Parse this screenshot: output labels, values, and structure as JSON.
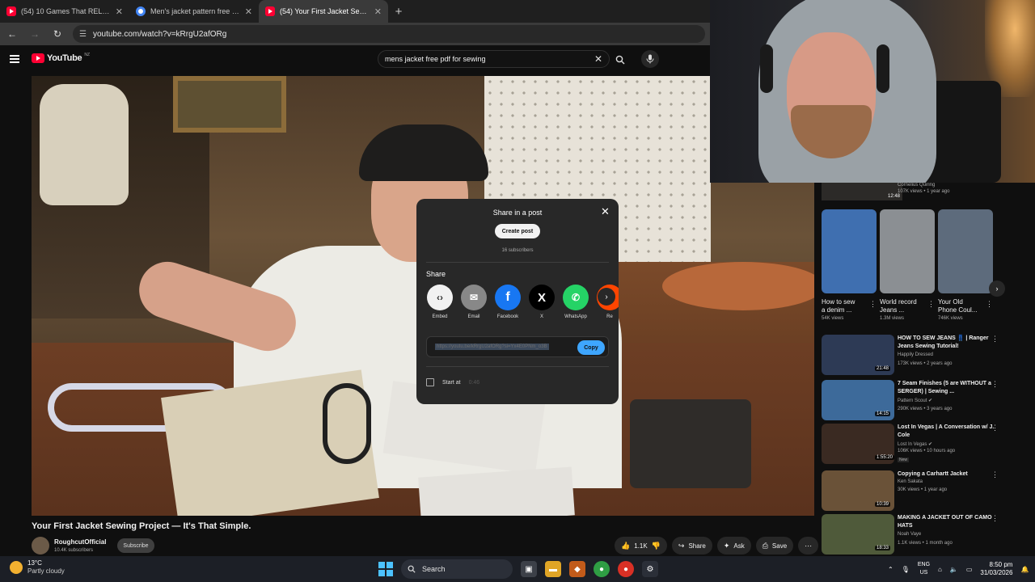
{
  "browser": {
    "tabs": [
      {
        "title": "(54) 10 Games That RELEASED",
        "icon": "youtube-icon",
        "active": false
      },
      {
        "title": "Men's jacket pattern free pdf fo",
        "icon": "google-icon",
        "active": false
      },
      {
        "title": "(54) Your First Jacket Sewing Pr",
        "icon": "youtube-icon",
        "active": true
      }
    ],
    "close_glyph": "✕",
    "new_tab_glyph": "+",
    "url": "youtube.com/watch?v=kRrgU2afORg"
  },
  "youtube": {
    "logo_text": "YouTube",
    "logo_country": "NZ",
    "search_query": "mens jacket free pdf for sewing",
    "clear_glyph": "✕"
  },
  "share_dialog": {
    "title": "Share in a post",
    "create_post": "Create post",
    "subscribers": "16 subscribers",
    "share_label": "Share",
    "targets": [
      {
        "label": "Embed",
        "glyph": "‹›",
        "color": "#f1f1f1",
        "icon": "embed-icon"
      },
      {
        "label": "Email",
        "glyph": "✉",
        "color": "#888888",
        "icon": "email-icon"
      },
      {
        "label": "Facebook",
        "glyph": "f",
        "color": "#1877f2",
        "icon": "facebook-icon"
      },
      {
        "label": "X",
        "glyph": "X",
        "color": "#000000",
        "icon": "x-icon"
      },
      {
        "label": "WhatsApp",
        "glyph": "✆",
        "color": "#25d366",
        "icon": "whatsapp-icon"
      },
      {
        "label": "Re",
        "glyph": "",
        "color": "#ff4500",
        "icon": "reddit-icon"
      }
    ],
    "link": "https://youtu.be/kRrgU2afORg?si=Yx4E0PNm_o3B",
    "copy": "Copy",
    "start_at_label": "Start at",
    "start_at_time": "0:46"
  },
  "video": {
    "title": "Your First Jacket Sewing Project — It's That Simple.",
    "channel": "RoughcutOfficial",
    "channel_subs": "10.4K subscribers",
    "subscribe": "Subscribe",
    "likes": "1.1K",
    "share": "Share",
    "ask": "Ask",
    "save": "Save"
  },
  "sidebar": {
    "top_item": {
      "duration": "12:48",
      "channel": "Cornelius Quiring",
      "meta": "107K views • 1 year ago"
    },
    "shorts": [
      {
        "title": "How to sew\na denim ...",
        "views": "54K views",
        "thumb": "#3f6fb0"
      },
      {
        "title": "World record\nJeans ...",
        "views": "1.3M views",
        "thumb": "#8b8f93"
      },
      {
        "title": "Your Old\nPhone Coul...",
        "views": "746K views",
        "thumb": "#5d6b7c"
      }
    ],
    "recommendations": [
      {
        "title": "HOW TO SEW JEANS 👖 | Ranger Jeans Sewing Tutorial!",
        "channel": "Happily Dressed",
        "meta": "173K views • 2 years ago",
        "duration": "21:48",
        "thumb": "#2d3a55",
        "verified": false,
        "new": false
      },
      {
        "title": "7 Seam Finishes (5 are WITHOUT a SERGER) | Sewing ...",
        "channel": "Pattern Scout ✔",
        "meta": "290K views • 3 years ago",
        "duration": "14:15",
        "thumb": "#3d6a9a",
        "verified": true,
        "new": false
      },
      {
        "title": "Lost In Vegas | A Conversation w/ J. Cole",
        "channel": "Lost In Vegas ✔",
        "meta": "106K views • 10 hours ago",
        "duration": "1:55:20",
        "thumb": "#3a2a22",
        "verified": true,
        "new": true,
        "new_label": "New"
      },
      {
        "title": "Copying a Carhartt Jacket",
        "channel": "Ken Sakata",
        "meta": "30K views • 1 year ago",
        "duration": "10:39",
        "thumb": "#6a5238",
        "verified": false,
        "new": false
      },
      {
        "title": "MAKING A JACKET OUT OF CAMO HATS",
        "channel": "Noah Vaye",
        "meta": "1.1K views • 1 month ago",
        "duration": "18:33",
        "thumb": "#4f5a3a",
        "verified": false,
        "new": false
      }
    ]
  },
  "taskbar": {
    "temp": "13°C",
    "condition": "Partly cloudy",
    "search": "Search",
    "lang": "ENG",
    "region": "US",
    "time": "8:50 pm",
    "date": "31/03/2026"
  }
}
